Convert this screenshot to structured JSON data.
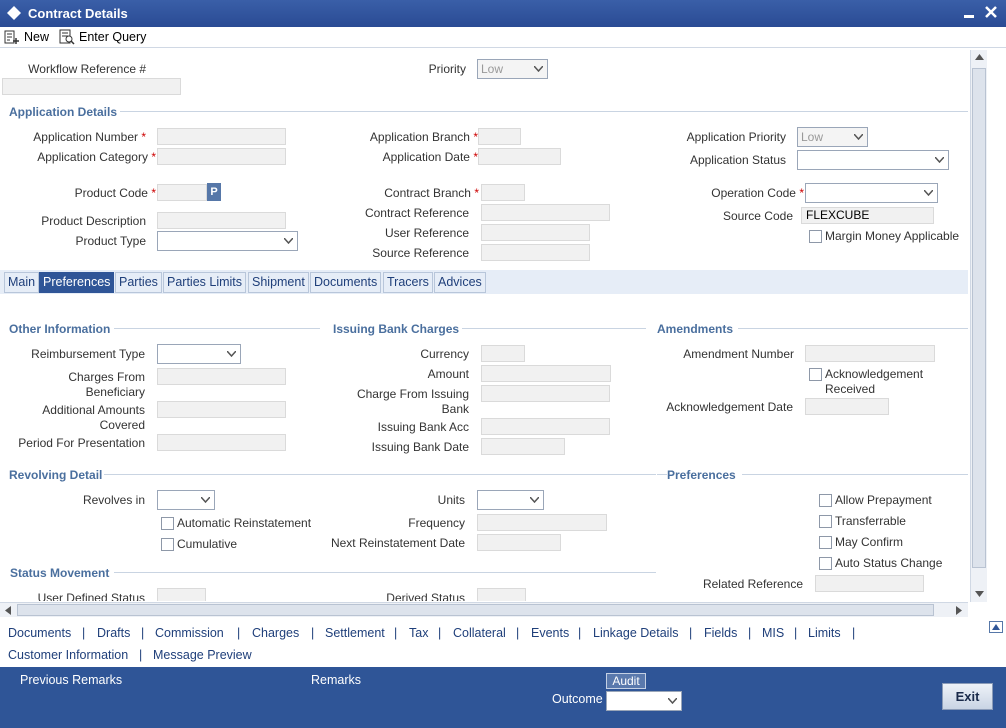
{
  "window": {
    "title": "Contract Details"
  },
  "toolbar": {
    "new_label": "New",
    "enter_query_label": "Enter Query"
  },
  "header": {
    "workflow_reference_label": "Workflow Reference #",
    "priority_label": "Priority",
    "priority_value": "Low"
  },
  "application_details": {
    "title": "Application Details",
    "application_number_label": "Application Number",
    "application_category_label": "Application Category",
    "product_code_label": "Product Code",
    "product_code_button": "P",
    "product_description_label": "Product Description",
    "product_type_label": "Product Type",
    "application_branch_label": "Application Branch",
    "application_date_label": "Application Date",
    "contract_branch_label": "Contract Branch",
    "contract_reference_label": "Contract Reference",
    "user_reference_label": "User Reference",
    "source_reference_label": "Source Reference",
    "application_priority_label": "Application Priority",
    "application_priority_value": "Low",
    "application_status_label": "Application Status",
    "operation_code_label": "Operation Code",
    "source_code_label": "Source Code",
    "source_code_value": "FLEXCUBE",
    "margin_money_label": "Margin Money Applicable"
  },
  "tabs": [
    "Main",
    "Preferences",
    "Parties",
    "Parties Limits",
    "Shipment",
    "Documents",
    "Tracers",
    "Advices"
  ],
  "other_information": {
    "title": "Other Information",
    "reimbursement_type_label": "Reimbursement Type",
    "charges_from_beneficiary_label_1": "Charges From",
    "charges_from_beneficiary_label_2": "Beneficiary",
    "additional_amounts_label_1": "Additional Amounts",
    "additional_amounts_label_2": "Covered",
    "period_for_presentation_label": "Period For Presentation"
  },
  "issuing_bank_charges": {
    "title": "Issuing Bank Charges",
    "currency_label": "Currency",
    "amount_label": "Amount",
    "charge_from_issuing_label_1": "Charge From Issuing",
    "charge_from_issuing_label_2": "Bank",
    "issuing_bank_acc_label": "Issuing Bank Acc",
    "issuing_bank_date_label": "Issuing Bank Date"
  },
  "amendments": {
    "title": "Amendments",
    "amendment_number_label": "Amendment Number",
    "acknowledgement_received_label_1": "Acknowledgement",
    "acknowledgement_received_label_2": "Received",
    "acknowledgement_date_label": "Acknowledgement Date"
  },
  "revolving_detail": {
    "title": "Revolving Detail",
    "revolves_in_label": "Revolves in",
    "automatic_reinstatement_label": "Automatic Reinstatement",
    "cumulative_label": "Cumulative",
    "units_label": "Units",
    "frequency_label": "Frequency",
    "next_reinstatement_date_label": "Next Reinstatement Date"
  },
  "preferences": {
    "title": "Preferences",
    "allow_prepayment_label": "Allow Prepayment",
    "transferrable_label": "Transferrable",
    "may_confirm_label": "May Confirm",
    "auto_status_change_label": "Auto Status Change",
    "related_reference_label": "Related Reference"
  },
  "status_movement": {
    "title": "Status Movement",
    "user_defined_status_label": "User Defined Status",
    "derived_status_label": "Derived Status"
  },
  "footer_links": {
    "row1": [
      "Documents",
      "Drafts",
      "Commission",
      "Charges",
      "Settlement",
      "Tax",
      "Collateral",
      "Events",
      "Linkage Details",
      "Fields",
      "MIS",
      "Limits"
    ],
    "row2": [
      "Customer Information",
      "Message Preview"
    ],
    "separator": "|"
  },
  "bottom_bar": {
    "previous_remarks_label": "Previous Remarks",
    "remarks_label": "Remarks",
    "audit_label": "Audit",
    "outcome_label": "Outcome",
    "exit_label": "Exit"
  },
  "colors": {
    "title_bar": "#2f5597",
    "bottom_bar": "#2f5597",
    "section_title": "#4a6f9e",
    "required": "#cc0000"
  }
}
